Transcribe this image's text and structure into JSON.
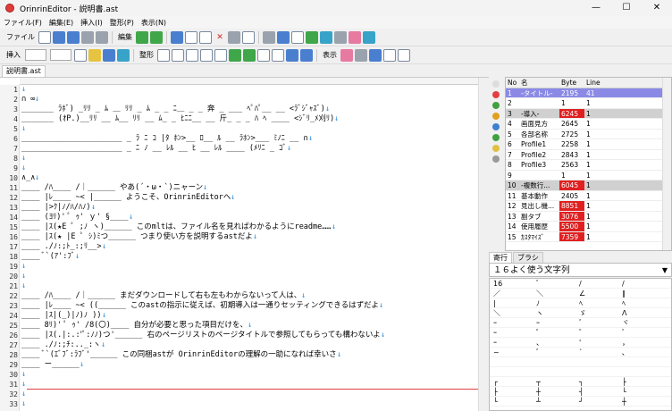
{
  "window": {
    "title": "OrinrinEditor - 説明書.ast",
    "min": "—",
    "max": "☐",
    "close": "✕"
  },
  "menu": [
    "ファイル(F)",
    "編集(E)",
    "挿入(I)",
    "整形(P)",
    "表示(N)"
  ],
  "toolbar1": {
    "label_file": "ファイル",
    "label_edit": "編集"
  },
  "toolbar2": {
    "label_insert": "挿入",
    "label_format": "整形",
    "label_view": "表示"
  },
  "file_tab": "説明書.ast",
  "editor_lines": [
    {
      "no": "1",
      "text": ""
    },
    {
      "no": "2",
      "text": "                          ∩                                    ∞"
    },
    {
      "no": "3",
      "text": "  _______ ﾗﾎﾞ) _ﾘﾘ _ ﾑ ＿ ﾘﾘ _ ﾑ _ _ ﾆ＿ _ _ 奔 _ ___ ﾍﾟﾊﾟ__ __ <ﾗﾞｼﾞｬｽﾞ)"
    },
    {
      "no": "4",
      "text": "  _______ (ｵP.)__ﾘﾘ __ ﾑ__ ﾘﾘ __ ﾑ_ _ ﾋﾆﾆ__ __ 斤_ _ _ ﾊ ﾍ ____ <ｼﾞﾘ_ﾒ刈ﾘ)"
    },
    {
      "no": "5",
      "text": ""
    },
    {
      "no": "6",
      "text": "  ______________________ _ ﾗ ﾆ ｺ |ﾀ ﾎﾝ>__ ﾛ__ ﾙ __ ﾗﾎﾝ>___ ﾐﾉﾆ __ ∩"
    },
    {
      "no": "7",
      "text": "  ______________________ _ ﾆ ﾉ __ ﾚﾙ __ ﾋ __ ﾚﾙ ____ (ﾒﾘﾆ _ ｺﾞ"
    },
    {
      "no": "8",
      "text": ""
    },
    {
      "no": "9",
      "text": ""
    },
    {
      "no": "10",
      "text": "                                    ∧_∧"
    },
    {
      "no": "11",
      "text": "  ____ /ﾊ____ /｜______ やあ(´・ω・`)ニャーン"
    },
    {
      "no": "12",
      "text": "  ____ |ﾚ____ ~< |______ ようこそ、OrinrinEditorへ"
    },
    {
      "no": "13",
      "text": "  ____ |>ｸ|ﾉ/ﾊ/ﾊﾉ)"
    },
    {
      "no": "14",
      "text": "  ____ (ﾖﾘ)'  ﾟ ｩ' ｙ'  §____"
    },
    {
      "no": "15",
      "text": "  ____ |ｽ(★E ﾟ ;ﾉ ヽ)______ このmltは、ファイル名を見ればわかるようにreadme……"
    },
    {
      "no": "16",
      "text": "  ____ |ｽ(★ |E ﾟ ｼ)ﾐつ______ つまり使い方を説明するastだよ"
    },
    {
      "no": "17",
      "text": "  ____ ./ﾉ:;ﾄ_:;ﾘ__>"
    },
    {
      "no": "18",
      "text": "  ____ ﾞ`(ｱ':ﾌﾞ"
    },
    {
      "no": "19",
      "text": ""
    },
    {
      "no": "20",
      "text": ""
    },
    {
      "no": "21",
      "text": ""
    },
    {
      "no": "22",
      "text": "  ____ /ﾊ____ /｜______ まだダウンロードして右も左もわからないって人は、"
    },
    {
      "no": "23",
      "text": "  ____ |ﾚ____ ~< ((______ このastの指示に従えば、初期導入は一通りセッティングできるはずだよ"
    },
    {
      "no": "24",
      "text": "  ____ |ｽ|(_)|ﾉ)ﾉ ))"
    },
    {
      "no": "25",
      "text": "  ____ 8ﾘ)'  ﾟ ｩ' /8(〇)____ 自分が必要と思った項目だけを、"
    },
    {
      "no": "26",
      "text": "  ____ |ｽ(.|:.:'ﾟ:ﾉﾉ)つ'______ 右のページリストのページタイトルで参照してもらっても構わないよ"
    },
    {
      "no": "27",
      "text": "  ____ ./ﾉ:;ﾁ:.._:ヽ"
    },
    {
      "no": "28",
      "text": "  ____ ﾞ`(ｴﾞﾌﾞ:ﾗﾌﾞ'______ この同梱astが OrinrinEditorの理解の一助になれば幸いさ"
    },
    {
      "no": "29",
      "text": "  ____ ー______"
    },
    {
      "no": "30",
      "text": ""
    },
    {
      "no": "31",
      "text": ""
    },
    {
      "no": "32",
      "text": ""
    },
    {
      "no": "33",
      "text": ""
    }
  ],
  "page_table": {
    "headers": [
      "No",
      "名",
      "Byte",
      "Line"
    ],
    "rows": [
      {
        "no": "1",
        "name": "-タイトル-",
        "byte": "2195",
        "line": "41",
        "state": "sel",
        "red": false
      },
      {
        "no": "2",
        "name": "",
        "byte": "1",
        "line": "1",
        "state": "",
        "red": false
      },
      {
        "no": "3",
        "name": "-導入-",
        "byte": "6245",
        "line": "1",
        "state": "gray",
        "red": true
      },
      {
        "no": "4",
        "name": "画面見方",
        "byte": "2645",
        "line": "1",
        "state": "",
        "red": false
      },
      {
        "no": "5",
        "name": "各部名称",
        "byte": "2725",
        "line": "1",
        "state": "",
        "red": false
      },
      {
        "no": "6",
        "name": "Profile1",
        "byte": "2258",
        "line": "1",
        "state": "",
        "red": false
      },
      {
        "no": "7",
        "name": "Profile2",
        "byte": "2843",
        "line": "1",
        "state": "",
        "red": false
      },
      {
        "no": "8",
        "name": "Profile3",
        "byte": "2563",
        "line": "1",
        "state": "",
        "red": false
      },
      {
        "no": "9",
        "name": "",
        "byte": "1",
        "line": "1",
        "state": "",
        "red": false
      },
      {
        "no": "10",
        "name": "-複数行...",
        "byte": "6045",
        "line": "1",
        "state": "gray",
        "red": true
      },
      {
        "no": "11",
        "name": "基本動作",
        "byte": "2405",
        "line": "1",
        "state": "",
        "red": false
      },
      {
        "no": "12",
        "name": "見出し機...",
        "byte": "8851",
        "line": "1",
        "state": "",
        "red": true
      },
      {
        "no": "13",
        "name": "副タブ",
        "byte": "3076",
        "line": "1",
        "state": "",
        "red": true
      },
      {
        "no": "14",
        "name": "使用履歴",
        "byte": "5500",
        "line": "1",
        "state": "",
        "red": true
      },
      {
        "no": "15",
        "name": "ｶｽﾀﾏｲｽﾞ",
        "byte": "7359",
        "line": "1",
        "state": "",
        "red": true
      }
    ]
  },
  "bottom_tabs": [
    "寄行",
    "ブラシ"
  ],
  "char_select": "１６よく使う文字列",
  "char_list": [
    [
      "16",
      "ﾞ",
      "/",
      "/"
    ],
    [
      "／",
      "＼",
      "∠",
      "∥"
    ],
    [
      "|",
      "ﾉ",
      "ﾍ",
      "ﾍ"
    ],
    [
      "＼",
      "ヽ",
      "ゞ",
      "Λ"
    ],
    [
      "ｰ",
      "ｰ",
      "ﾞ",
      "ヾ"
    ],
    [
      "ｰ",
      "ﾟ",
      "゛",
      "ﾞ"
    ],
    [
      "ｰ",
      "、",
      "'",
      "，"
    ],
    [
      "~",
      "ﾞ",
      "`",
      "､"
    ],
    [
      "",
      "",
      "",
      ""
    ],
    [
      "",
      "",
      "",
      ""
    ],
    [
      "┌",
      "┬",
      "┐",
      "├"
    ],
    [
      "├",
      "┼",
      "┤",
      "└"
    ],
    [
      "└",
      "┴",
      "┘",
      "┼"
    ]
  ]
}
